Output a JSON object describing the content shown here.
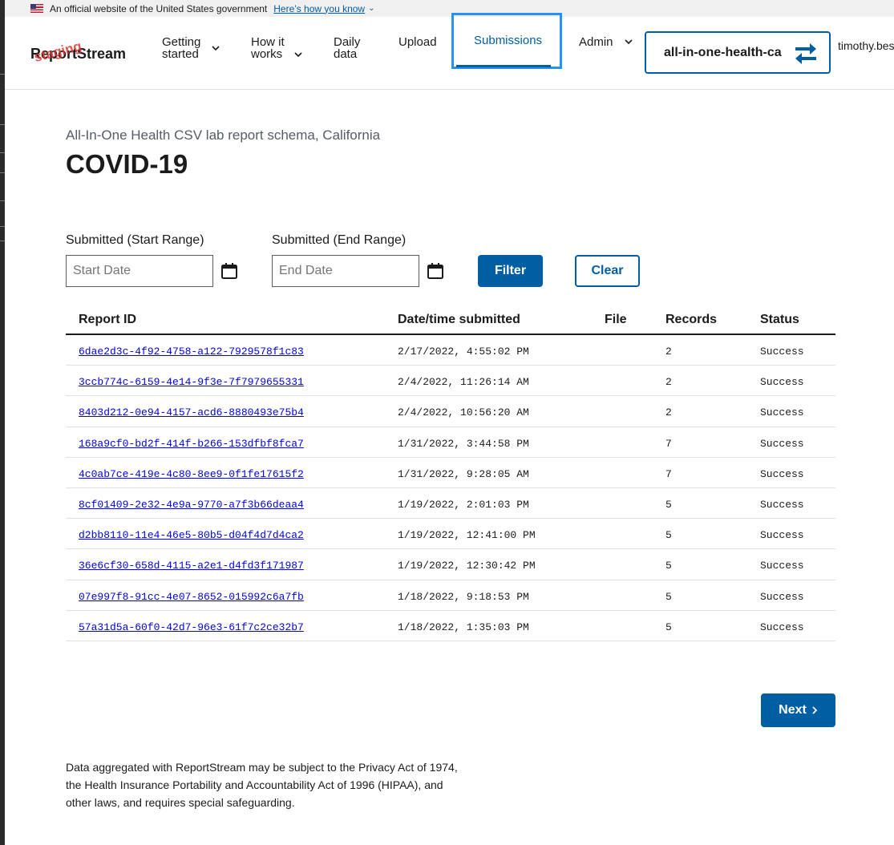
{
  "banner": {
    "text": "An official website of the United States government",
    "link": "Here’s how you know"
  },
  "header": {
    "logo": "ReportStream",
    "logo_tag": "staging",
    "nav": {
      "getting_started": "Getting started",
      "how_it_works": "How it works",
      "daily_data": "Daily data",
      "upload": "Upload",
      "submissions": "Submissions",
      "admin": "Admin"
    },
    "org": "all-in-one-health-ca",
    "user": "timothy.bes"
  },
  "page": {
    "subtitle": "All-In-One Health CSV lab report schema, California",
    "title": "COVID-19"
  },
  "filters": {
    "start_label": "Submitted (Start Range)",
    "end_label": "Submitted (End Range)",
    "start_placeholder": "Start Date",
    "end_placeholder": "End Date",
    "filter_button": "Filter",
    "clear_button": "Clear"
  },
  "table": {
    "headers": [
      "Report ID",
      "Date/time submitted",
      "File",
      "Records",
      "Status"
    ],
    "rows": [
      {
        "id": "6dae2d3c-4f92-4758-a122-7929578f1c83",
        "date": "2/17/2022, 4:55:02 PM",
        "file": "",
        "records": "2",
        "status": "Success"
      },
      {
        "id": "3ccb774c-6159-4e14-9f3e-7f7979655331",
        "date": "2/4/2022, 11:26:14 AM",
        "file": "",
        "records": "2",
        "status": "Success"
      },
      {
        "id": "8403d212-0e94-4157-acd6-8880493e75b4",
        "date": "2/4/2022, 10:56:20 AM",
        "file": "",
        "records": "2",
        "status": "Success"
      },
      {
        "id": "168a9cf0-bd2f-414f-b266-153dfbf8fca7",
        "date": "1/31/2022, 3:44:58 PM",
        "file": "",
        "records": "7",
        "status": "Success"
      },
      {
        "id": "4c0ab7ce-419e-4c80-8ee9-0f1fe17615f2",
        "date": "1/31/2022, 9:28:05 AM",
        "file": "",
        "records": "7",
        "status": "Success"
      },
      {
        "id": "8cf01409-2e32-4e9a-9770-a7f3b66deaa4",
        "date": "1/19/2022, 2:01:03 PM",
        "file": "",
        "records": "5",
        "status": "Success"
      },
      {
        "id": "d2bb8110-11e4-46e5-80b5-d04f4d7d4ca2",
        "date": "1/19/2022, 12:41:00 PM",
        "file": "",
        "records": "5",
        "status": "Success"
      },
      {
        "id": "36e6cf30-658d-4115-a2e1-d4fd3f171987",
        "date": "1/19/2022, 12:30:42 PM",
        "file": "",
        "records": "5",
        "status": "Success"
      },
      {
        "id": "07e997f8-91cc-4e07-8652-015992c6a7fb",
        "date": "1/18/2022, 9:18:53 PM",
        "file": "",
        "records": "5",
        "status": "Success"
      },
      {
        "id": "57a31d5a-60f0-42d7-96e3-61f7c2ce32b7",
        "date": "1/18/2022, 1:35:03 PM",
        "file": "",
        "records": "5",
        "status": "Success"
      }
    ]
  },
  "pagination": {
    "next": "Next"
  },
  "footer": {
    "note": "Data aggregated with ReportStream may be subject to the Privacy Act of 1974, the Health Insurance Portability and Accountability Act of 1996 (HIPAA), and other laws, and requires special safeguarding."
  },
  "colors": {
    "primary": "#005ea2",
    "focus": "#2491ff",
    "staging": "#d83933",
    "link": "#0000ee"
  },
  "icons": [
    "chevron-down-icon",
    "swap-arrows-icon",
    "calendar-icon",
    "chevron-right-icon",
    "us-flag-icon"
  ]
}
